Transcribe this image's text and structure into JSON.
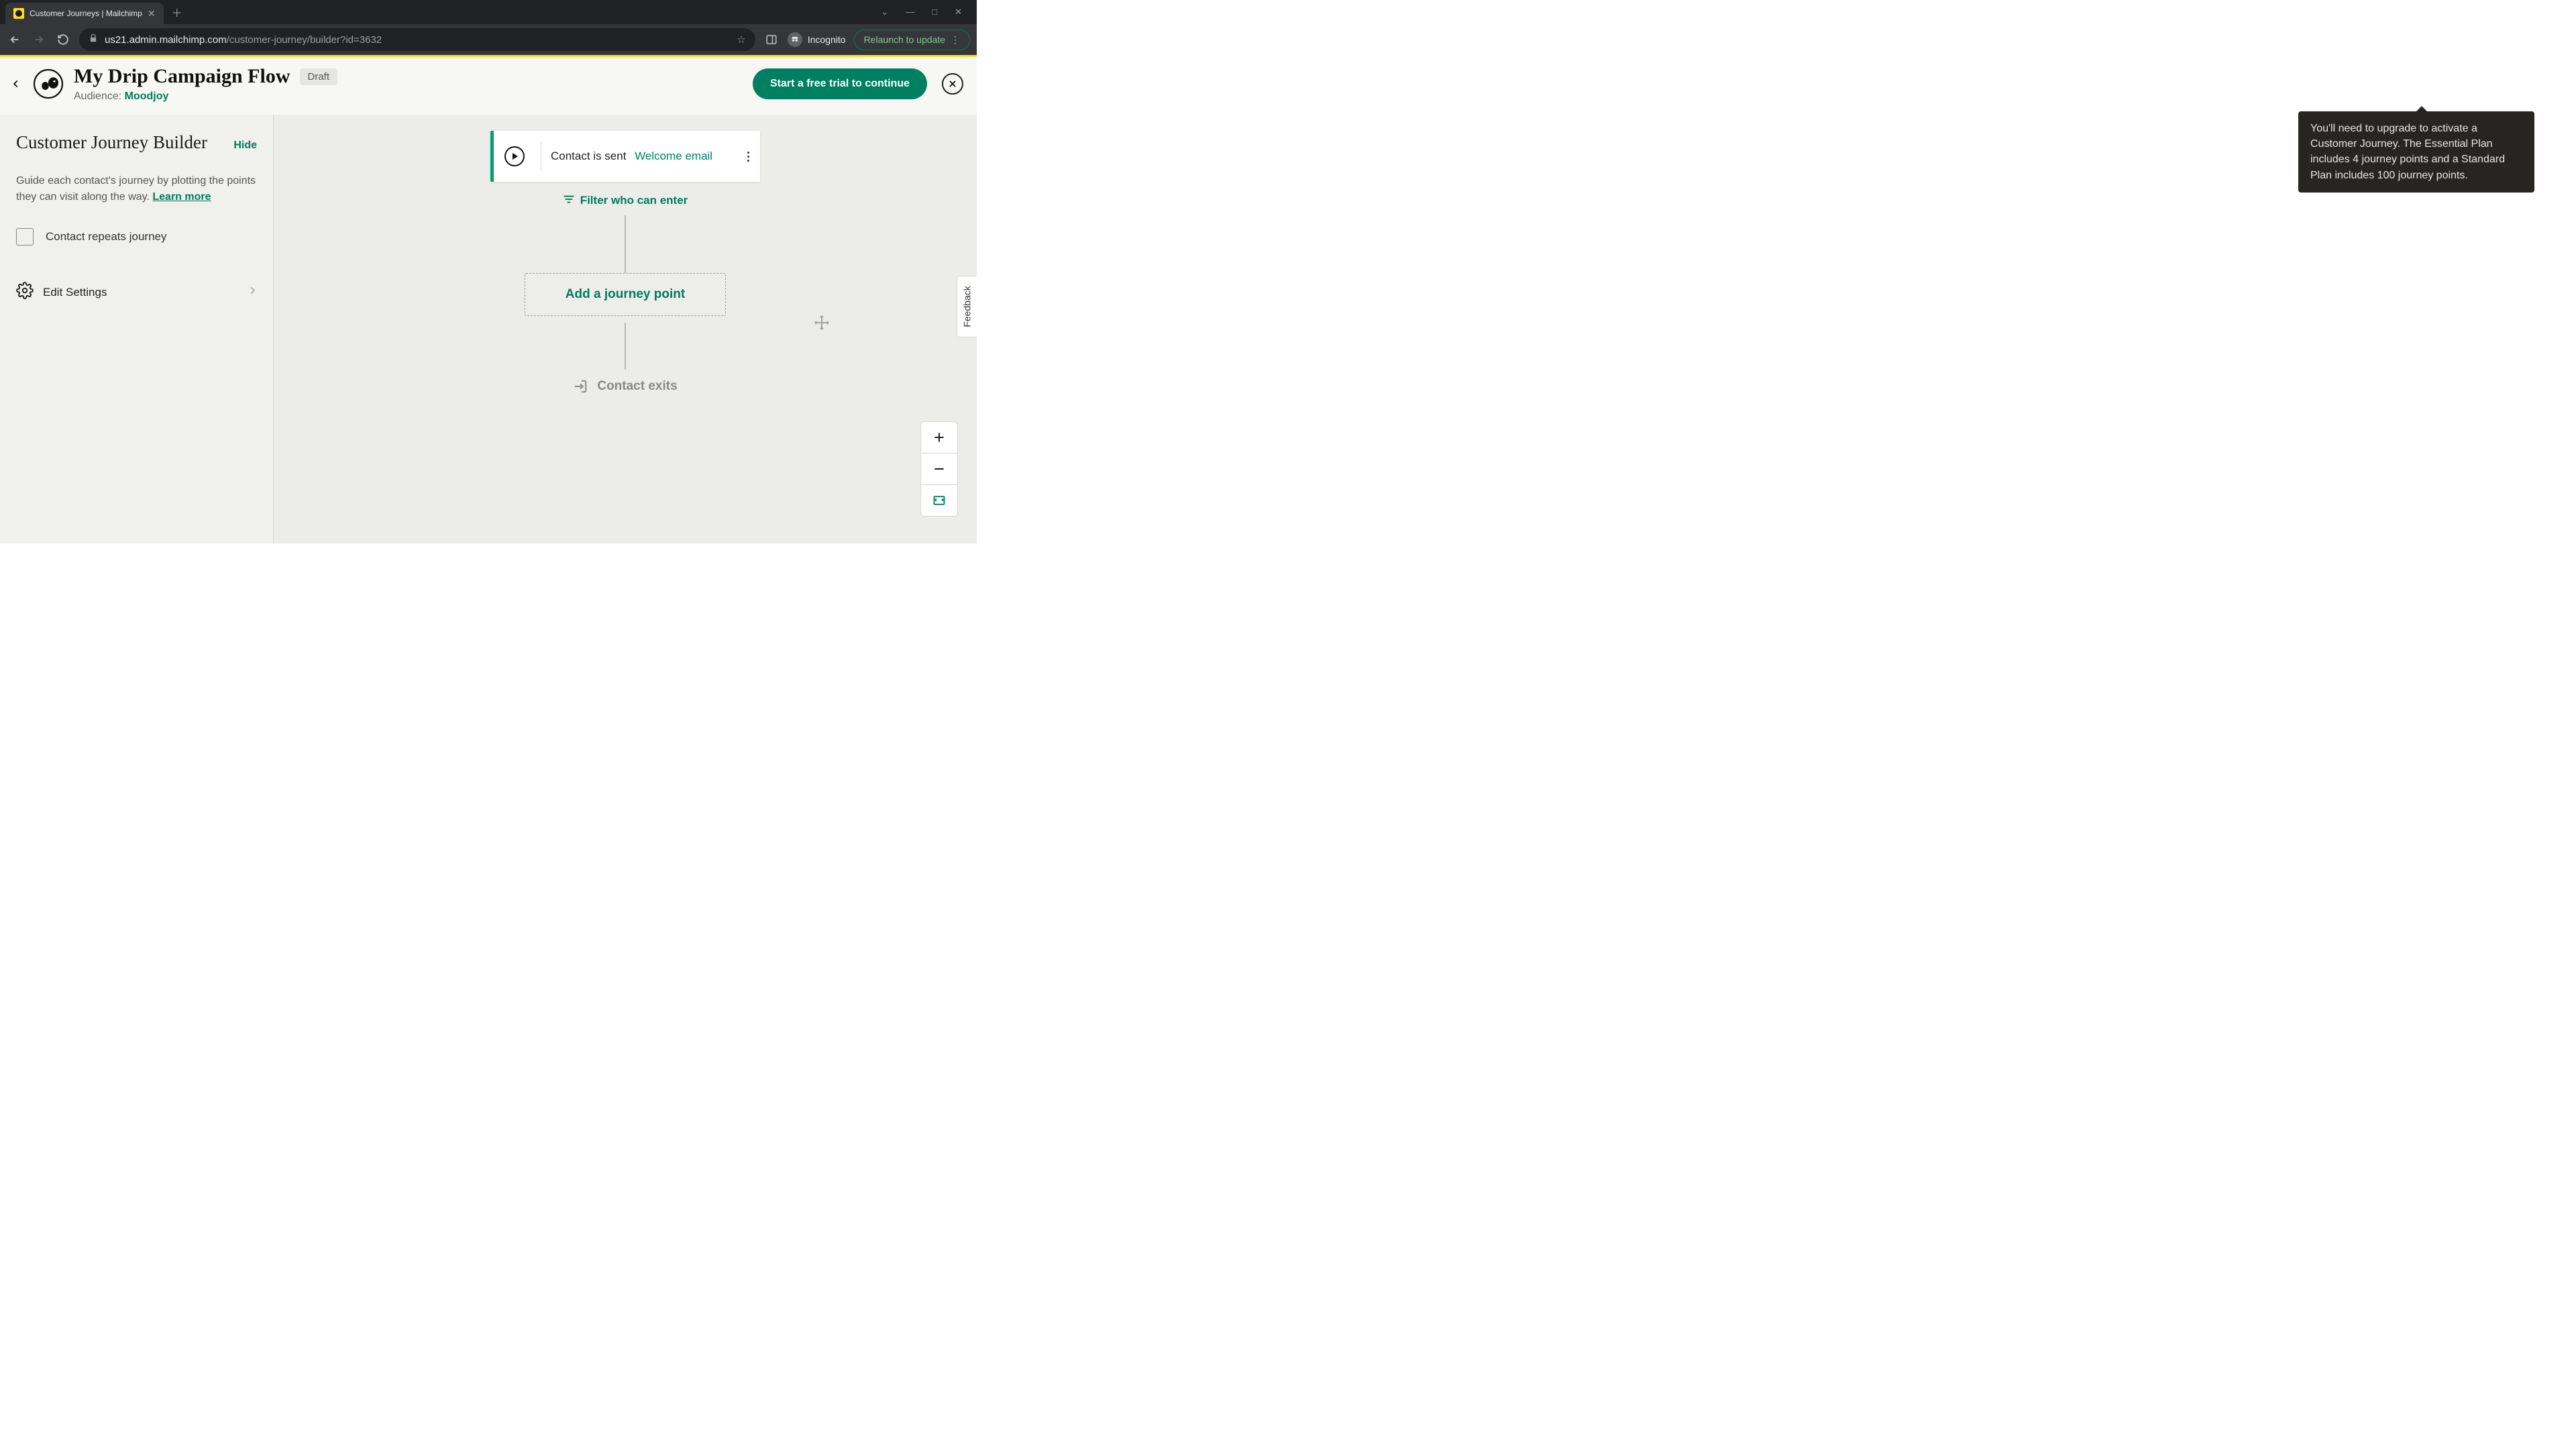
{
  "browser": {
    "tab_title": "Customer Journeys | Mailchimp",
    "url_domain": "us21.admin.mailchimp.com",
    "url_path": "/customer-journey/builder?id=3632",
    "incognito_label": "Incognito",
    "relaunch_label": "Relaunch to update"
  },
  "header": {
    "title": "My Drip Campaign Flow",
    "status_badge": "Draft",
    "audience_label": "Audience:",
    "audience_name": "Moodjoy",
    "trial_button": "Start a free trial to continue"
  },
  "tooltip": {
    "text": "You'll need to upgrade to activate a Customer Journey. The Essential Plan includes 4 journey points and a Standard Plan includes 100 journey points."
  },
  "sidebar": {
    "title": "Customer Journey Builder",
    "hide_label": "Hide",
    "description_prefix": "Guide each contact's journey by plotting the points they can visit along the way. ",
    "learn_more": "Learn more",
    "repeat_checkbox": "Contact repeats journey",
    "edit_settings": "Edit Settings"
  },
  "canvas": {
    "start_text": "Contact is sent",
    "start_link": "Welcome email",
    "filter_label": "Filter who can enter",
    "add_point": "Add a journey point",
    "exit_label": "Contact exits"
  },
  "feedback": {
    "label": "Feedback"
  }
}
